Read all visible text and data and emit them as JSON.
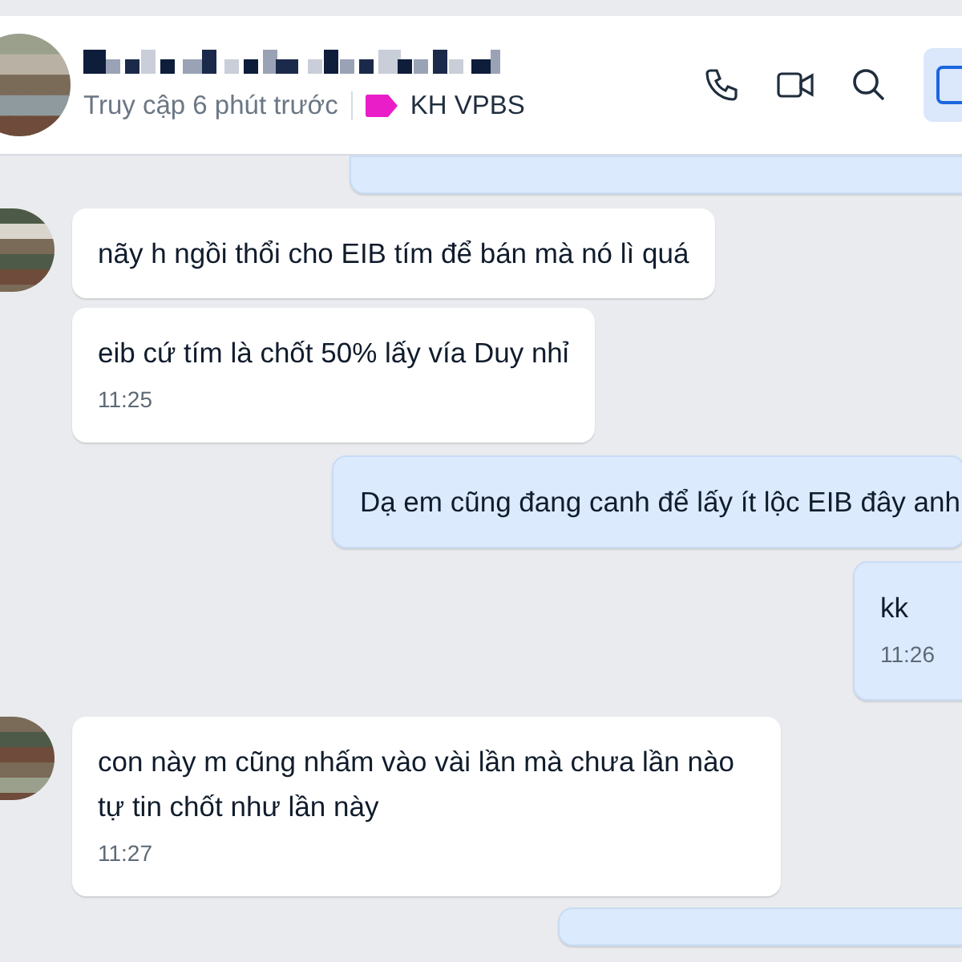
{
  "header": {
    "status": "Truy cập 6 phút trước",
    "tag": {
      "label": "KH VPBS",
      "color": "#e91ec8"
    }
  },
  "messages": [
    {
      "kind": "outgoing",
      "partial": true
    },
    {
      "kind": "incoming",
      "avatar": true,
      "text": "nãy h ngồi thổi cho EIB tím để bán mà nó lì quá"
    },
    {
      "kind": "incoming",
      "avatar": false,
      "text": "eib cứ tím là chốt 50% lấy vía Duy nhỉ",
      "time": "11:25"
    },
    {
      "kind": "outgoing",
      "text": "Dạ em cũng đang canh để lấy ít lộc EIB đây anh"
    },
    {
      "kind": "outgoing",
      "text": "kk",
      "time": "11:26"
    },
    {
      "kind": "incoming",
      "avatar": true,
      "text": "con này m cũng nhấm vào vài lần mà chưa lần nào tự tin chốt như lần này",
      "time": "11:27"
    },
    {
      "kind": "outgoing",
      "partial": true
    }
  ]
}
